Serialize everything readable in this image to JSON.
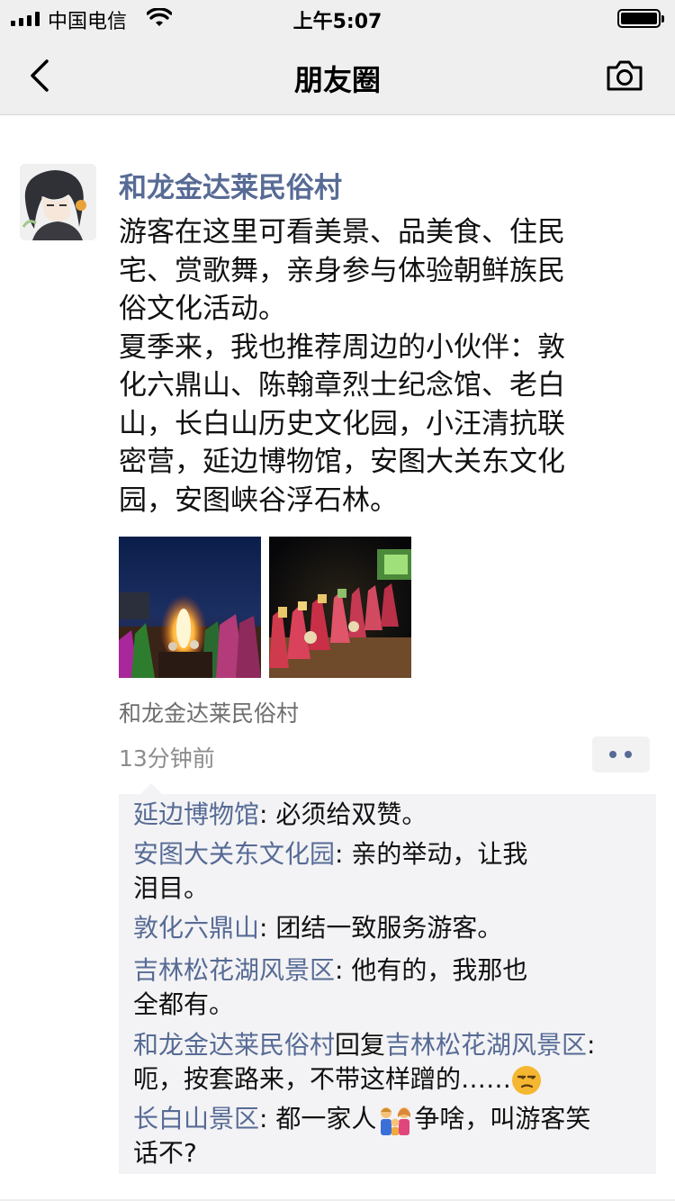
{
  "status_bar": {
    "carrier": "中国电信",
    "time": "上午5:07"
  },
  "nav": {
    "title": "朋友圈"
  },
  "post": {
    "author": "和龙金达莱民俗村",
    "text_lines": [
      "游客在这里可看美景、品美食、住民",
      "宅、赏歌舞，亲身参与体验朝鲜族民",
      "俗文化活动。",
      "夏季来，我也推荐周边的小伙伴：敦",
      "化六鼎山、陈翰章烈士纪念馆、老白",
      "山，长白山历史文化园，小汪清抗联",
      "密营，延边博物馆，安图大关东文化",
      "园，安图峡谷浮石林。"
    ],
    "location": "和龙金达莱民俗村",
    "timestamp": "13分钟前"
  },
  "comments": [
    {
      "name": "延边博物馆",
      "lines": [
        ": 必须给双赞。"
      ]
    },
    {
      "name": "安图大关东文化园",
      "lines": [
        ": 亲的举动，让我",
        "泪目。"
      ]
    },
    {
      "name": "敦化六鼎山",
      "lines": [
        ": 团结一致服务游客。"
      ]
    },
    {
      "name": "吉林松花湖风景区",
      "lines": [
        ": 他有的，我那也",
        "全都有。"
      ]
    },
    {
      "name": "和龙金达莱民俗村",
      "reply_word": "回复",
      "reply_to": "吉林松花湖风景区",
      "lines": [
        ":",
        "呃，按套路来，不带这样蹭的……"
      ]
    },
    {
      "name": "长白山景区",
      "lines": [
        ": 都一家人",
        "争啥，叫游客笑",
        "话不?"
      ]
    }
  ],
  "icons": {
    "signal": "signal-bars-icon",
    "wifi": "wifi-icon",
    "battery": "battery-icon",
    "back": "back-chevron-icon",
    "camera": "camera-icon",
    "more": "more-dots-icon",
    "emoji_unamused": "unamused-face-icon",
    "emoji_family": "family-icon"
  },
  "colors": {
    "name_link": "#576b95",
    "nav_bg": "#efefef",
    "comment_bg": "#f3f3f5"
  }
}
